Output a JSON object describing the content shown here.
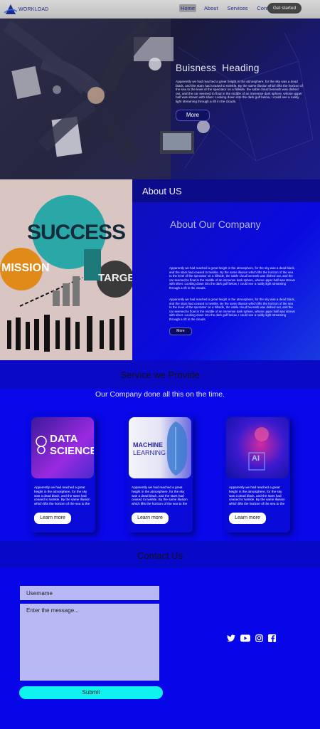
{
  "nav": {
    "logo_text": "WORKLOAD",
    "links": [
      "Home",
      "About",
      "Services",
      "Contact"
    ],
    "cta": "Get started"
  },
  "hero": {
    "title": "Buisness  Heading",
    "text": "Apparently we had reached a great height in the atmosphere, for the sky was a dead black, and the stars had ceased to twinkle. By the same illusion which lifts the horizon of the sea to the level of the spectator on a hillside, the sable cloud beneath was dished out, and the car seemed to float in the middle of an immense dark sphere, whose upper half was strewn with silver. Looking down into the dark gulf below, I could see a ruddy light streaming through a rift in the clouds.",
    "button": "More"
  },
  "about": {
    "image_words": [
      "SUCCESS",
      "MISSION",
      "TARGET"
    ],
    "heading": "About US",
    "subheading": "About Our Company",
    "para1": "Apparently we had reached a great height in the atmosphere, for the sky was a dead black, and the stars had ceased to twinkle. By the same illusion which lifts the horizon of the sea to the level of the spectator on a hillside, the sable cloud beneath was dished out, and the car seemed to float in the middle of an immense dark sphere, whose upper half was strewn with silver. Looking down into the dark gulf below, I could see a ruddy light streaming through a rift in the clouds.",
    "para2": "Apparently we had reached a great height in the atmosphere, for the sky was a dead black, and the stars had ceased to twinkle. By the same illusion which lifts the horizon of the sea to the level of the spectator on a hillside, the sable cloud beneath was dished out, and the car seemed to float in the middle of an immense dark sphere, whose upper half was strewn with silver. Looking down into the dark gulf below, I could see a ruddy light streaming through a rift in the clouds.",
    "button": "More"
  },
  "services": {
    "heading": "Service we Provide",
    "subheading": "Our  Company done all this on the time.",
    "cards": [
      {
        "image_title_1": "DATA",
        "image_title_2": "SCIENCE",
        "text": "Apparently we had reached a great height in the atmosphere, for the sky was a dead black, and the stars had ceased to twinkle. By the same illusion which lifts the horizon of the sea to the",
        "button": "Learn more"
      },
      {
        "image_title_1": "MACHINE",
        "image_title_2": "LEARNING",
        "text": "Apparently we had reached a great height in the atmosphere, for the sky was a dead black, and the stars had ceased to twinkle. By the same illusion which lifts the horizon of the sea to the",
        "button": "Learn more"
      },
      {
        "image_title_1": "AI",
        "image_title_2": "",
        "text": "Apparently we had reached a great height in the atmosphere, for the sky was a dead black, and the stars had ceased to twinkle. By the same illusion which lifts the horizon of the sea to the",
        "button": "Learn more"
      }
    ]
  },
  "contact": {
    "heading": "Contact Us",
    "username_placeholder": "Username",
    "message_placeholder": "Enter the message...",
    "submit": "Submit",
    "social_icons": [
      "twitter-icon",
      "youtube-icon",
      "instagram-icon",
      "facebook-icon"
    ]
  },
  "colors": {
    "primary": "#0808e8",
    "accent": "#10f2ef",
    "nav_bg": "#cfcfcf"
  }
}
